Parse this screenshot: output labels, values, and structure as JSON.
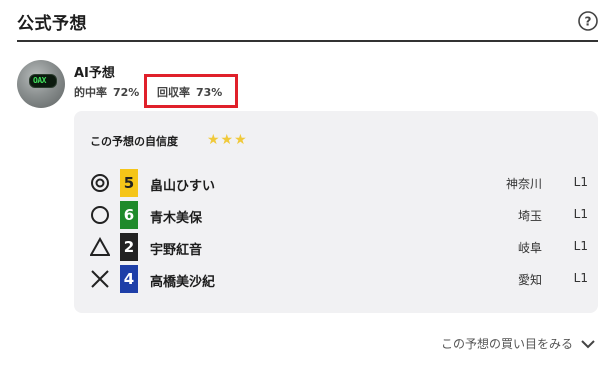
{
  "header": {
    "title": "公式予想"
  },
  "ai": {
    "name": "AI予想",
    "logo_text": "OAX",
    "hit_rate_label": "的中率",
    "hit_rate_value": "72%",
    "return_rate_label": "回収率",
    "return_rate_value": "73%"
  },
  "confidence": {
    "label": "この予想の自信度",
    "stars": "★★★",
    "rating": 3
  },
  "predictions": [
    {
      "mark": "double-circle",
      "number": "5",
      "box_bg": "#f5c518",
      "box_fg": "#222222",
      "name": "畠山ひすい",
      "prefecture": "神奈川",
      "license": "L1"
    },
    {
      "mark": "circle",
      "number": "6",
      "box_bg": "#1f8a2b",
      "box_fg": "#ffffff",
      "name": "青木美保",
      "prefecture": "埼玉",
      "license": "L1"
    },
    {
      "mark": "triangle",
      "number": "2",
      "box_bg": "#222222",
      "box_fg": "#ffffff",
      "name": "宇野紅音",
      "prefecture": "岐阜",
      "license": "L1"
    },
    {
      "mark": "cross",
      "number": "4",
      "box_bg": "#1e3fa8",
      "box_fg": "#ffffff",
      "name": "高橋美沙紀",
      "prefecture": "愛知",
      "license": "L1"
    }
  ],
  "footer": {
    "more_label": "この予想の買い目をみる"
  }
}
